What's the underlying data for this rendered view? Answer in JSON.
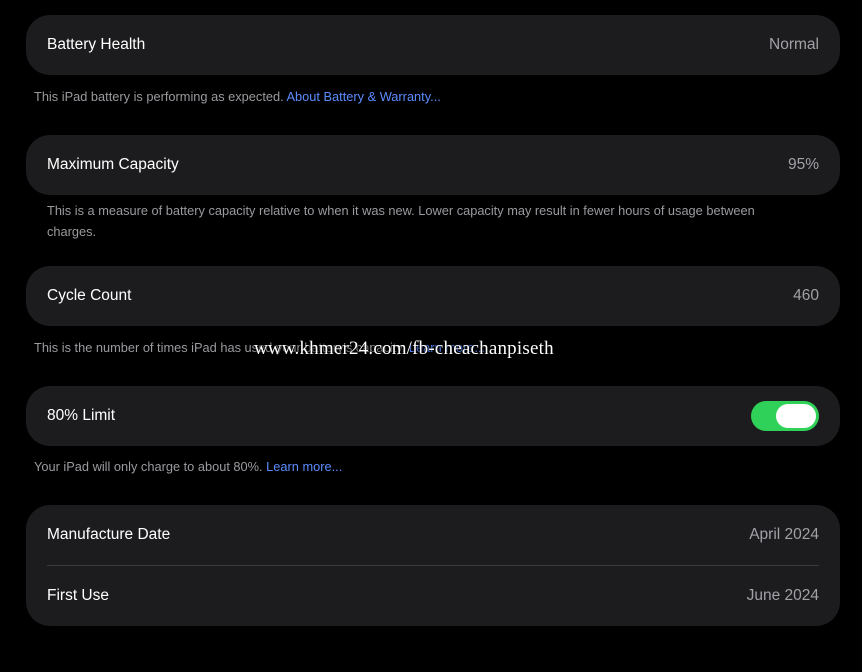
{
  "battery_health": {
    "label": "Battery Health",
    "value": "Normal",
    "footnote": "This iPad battery is performing as expected. ",
    "footnote_link": "About Battery & Warranty..."
  },
  "maximum_capacity": {
    "label": "Maximum Capacity",
    "value": "95%",
    "footnote": "This is a measure of battery capacity relative to when it was new. Lower capacity may result in fewer hours of usage between charges."
  },
  "cycle_count": {
    "label": "Cycle Count",
    "value": "460",
    "footnote": "This is the number of times iPad has used your battery's capacity. ",
    "footnote_link": "Learn more..."
  },
  "limit_80": {
    "label": "80% Limit",
    "enabled": true,
    "footnote": "Your iPad will only charge to about 80%. ",
    "footnote_link": "Learn more..."
  },
  "dates": {
    "manufacture_label": "Manufacture Date",
    "manufacture_value": "April 2024",
    "first_use_label": "First Use",
    "first_use_value": "June 2024"
  },
  "watermark": "www.khmer24.com/fb-cheachanpiseth",
  "colors": {
    "background": "#000000",
    "card": "#1c1c1e",
    "link": "#5b8cff",
    "toggle_on": "#30d158"
  }
}
